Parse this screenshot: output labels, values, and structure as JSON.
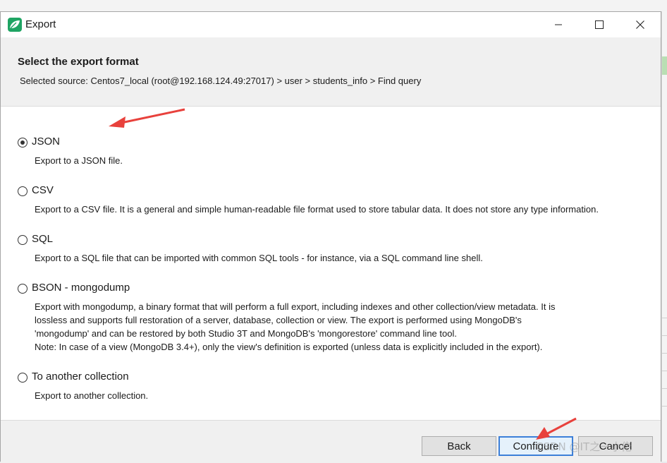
{
  "window": {
    "title": "Export",
    "icon": "studio3t-leaf-icon",
    "controls": [
      "minimize-icon",
      "maximize-icon",
      "close-icon"
    ]
  },
  "header": {
    "title": "Select the export format",
    "source": "Selected source: Centos7_local (root@192.168.124.49:27017) > user > students_info > Find query"
  },
  "options": [
    {
      "label": "JSON",
      "selected": true,
      "description": [
        "Export to a JSON file."
      ]
    },
    {
      "label": "CSV",
      "selected": false,
      "description": [
        "Export to a CSV file. It is a general and simple human-readable file format used to store tabular data. It does not store any type information."
      ]
    },
    {
      "label": "SQL",
      "selected": false,
      "description": [
        "Export to a SQL file that can be imported with common SQL tools - for instance, via a SQL command line shell."
      ]
    },
    {
      "label": "BSON - mongodump",
      "selected": false,
      "description": [
        "Export with mongodump, a binary format that will perform a full export, including indexes and other collection/view metadata. It is",
        "lossless and supports full restoration of a server, database, collection or view. The export is performed using MongoDB's",
        "'mongodump' and can be restored by both Studio 3T and MongoDB's 'mongorestore' command line tool.",
        "Note: In case of a view (MongoDB 3.4+), only the view's definition is exported (unless data is explicitly included in the export)."
      ]
    },
    {
      "label": "To another collection",
      "selected": false,
      "description": [
        "Export to another collection."
      ]
    }
  ],
  "buttons": {
    "back": "Back",
    "configure": "Configure",
    "cancel": "Cancel"
  },
  "watermark": "CSDN @IT之一小佬",
  "colors": {
    "annotation_arrow": "#e8413c",
    "default_button_border": "#3c7fd8",
    "app_icon": "#1fa463"
  }
}
